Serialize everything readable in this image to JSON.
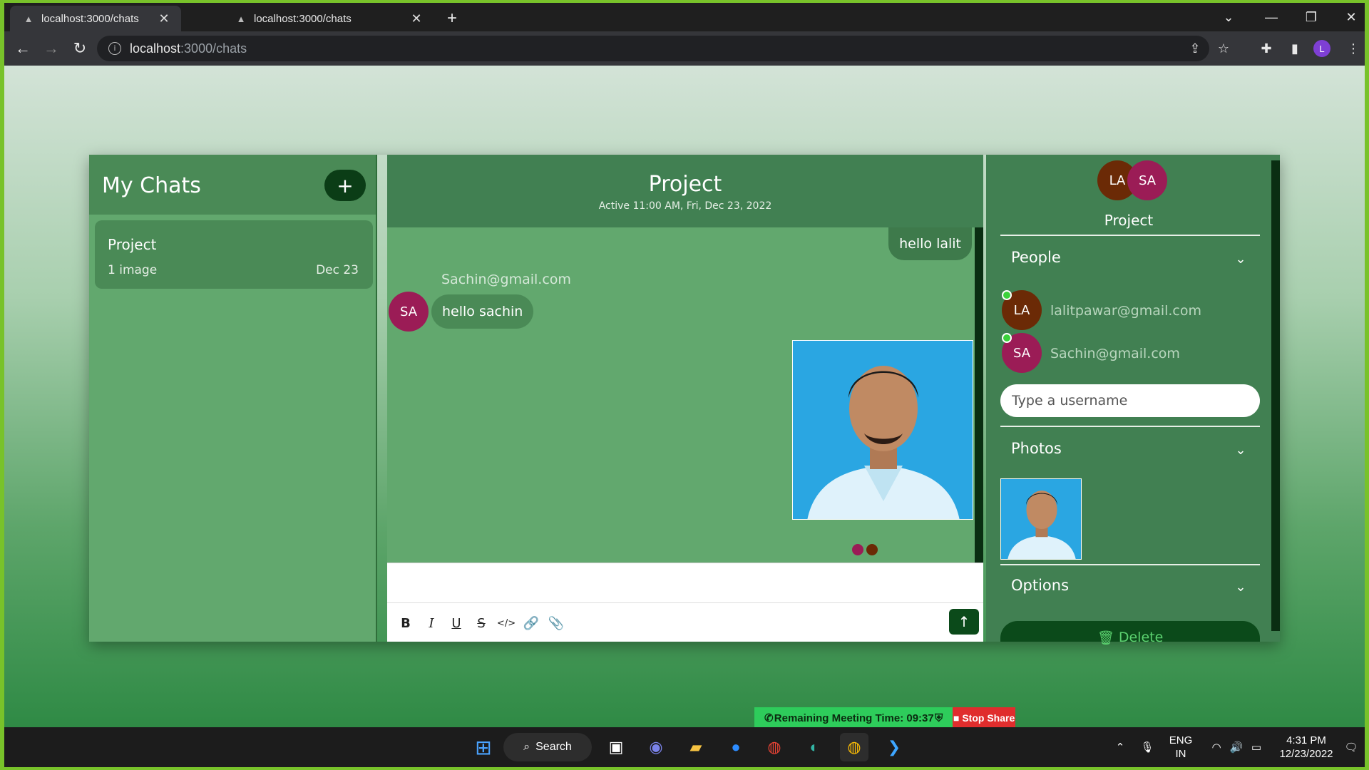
{
  "browser": {
    "tabs": [
      {
        "title": "localhost:3000/chats",
        "active": true
      },
      {
        "title": "localhost:3000/chats",
        "active": false
      }
    ],
    "url_host": "localhost",
    "url_path": ":3000/chats",
    "profile_initial": "L"
  },
  "sidebar": {
    "title": "My Chats",
    "add_label": "+",
    "chats": [
      {
        "name": "Project",
        "last_message": "1 image",
        "date": "Dec 23"
      }
    ]
  },
  "conversation": {
    "title": "Project",
    "status": "Active 11:00 AM, Fri, Dec 23, 2022",
    "messages": {
      "outgoing_text": "hello lalit",
      "incoming_sender": "Sachin@gmail.com",
      "incoming_avatar": "SA",
      "incoming_text": "hello sachin"
    },
    "seen_colors": [
      "#9b1c56",
      "#6b2a06"
    ],
    "toolbar": [
      "B",
      "I",
      "U",
      "S",
      "</>",
      "link",
      "attach"
    ]
  },
  "details": {
    "avatars": [
      "LA",
      "SA"
    ],
    "title": "Project",
    "people_label": "People",
    "people": [
      {
        "initials": "LA",
        "email": "lalitpawar@gmail.com",
        "online": true
      },
      {
        "initials": "SA",
        "email": "Sachin@gmail.com",
        "online": true
      }
    ],
    "username_placeholder": "Type a username",
    "photos_label": "Photos",
    "options_label": "Options",
    "delete_label": "Delete"
  },
  "zoom": {
    "remaining": "Remaining Meeting Time: 09:37",
    "stop": "Stop Share"
  },
  "taskbar": {
    "search_label": "Search",
    "lang_top": "ENG",
    "lang_bottom": "IN",
    "time": "4:31 PM",
    "date": "12/23/2022"
  },
  "colors": {
    "accent": "#0b4a1a",
    "panel": "#418052",
    "chat_bg": "#62a86e"
  }
}
